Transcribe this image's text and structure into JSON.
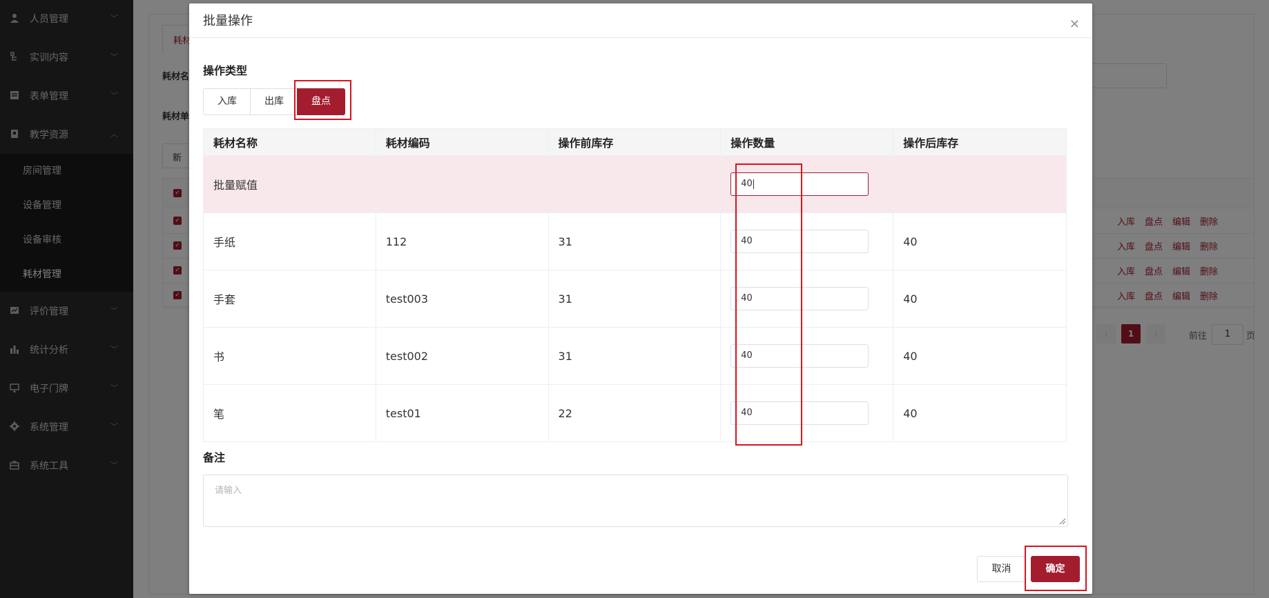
{
  "sidebar": {
    "items": [
      {
        "label": "人员管理",
        "icon": "user-icon"
      },
      {
        "label": "实训内容",
        "icon": "tree-icon"
      },
      {
        "label": "表单管理",
        "icon": "form-icon"
      },
      {
        "label": "教学资源",
        "icon": "book-icon",
        "expanded": true
      },
      {
        "label": "评价管理",
        "icon": "evaluation-icon"
      },
      {
        "label": "统计分析",
        "icon": "bar-chart-icon"
      },
      {
        "label": "电子门牌",
        "icon": "monitor-icon"
      },
      {
        "label": "系统管理",
        "icon": "gear-icon"
      },
      {
        "label": "系统工具",
        "icon": "toolbox-icon"
      }
    ],
    "subitems": [
      "房间管理",
      "设备管理",
      "设备审核",
      "耗材管理"
    ],
    "active_subitem": "耗材管理"
  },
  "background": {
    "tab_label": "耗材",
    "field_label_1": "耗材名",
    "field_label_2": "耗材单",
    "new_button": "新",
    "row_actions": [
      "入库",
      "盘点",
      "编辑",
      "删除"
    ],
    "pagination": {
      "current_page": "1",
      "goto_label": "前往",
      "goto_value": "1",
      "page_suffix": "页"
    }
  },
  "dialog": {
    "title": "批量操作",
    "operation_type_label": "操作类型",
    "operation_types": [
      "入库",
      "出库",
      "盘点"
    ],
    "selected_operation": "盘点",
    "table": {
      "headers": [
        "耗材名称",
        "耗材编码",
        "操作前库存",
        "操作数量",
        "操作后库存"
      ],
      "batch_row": {
        "name": "批量赋值",
        "quantity": "40"
      },
      "rows": [
        {
          "name": "手纸",
          "code": "112",
          "before": "31",
          "quantity": "40",
          "after": "40"
        },
        {
          "name": "手套",
          "code": "test003",
          "before": "31",
          "quantity": "40",
          "after": "40"
        },
        {
          "name": "书",
          "code": "test002",
          "before": "31",
          "quantity": "40",
          "after": "40"
        },
        {
          "name": "笔",
          "code": "test01",
          "before": "22",
          "quantity": "40",
          "after": "40"
        }
      ]
    },
    "remark_label": "备注",
    "remark_placeholder": "请输入",
    "cancel_label": "取消",
    "confirm_label": "确定"
  },
  "colors": {
    "accent": "#a31d2f",
    "highlight_box": "#d9121b",
    "sidebar_bg": "#2b2b2b"
  }
}
